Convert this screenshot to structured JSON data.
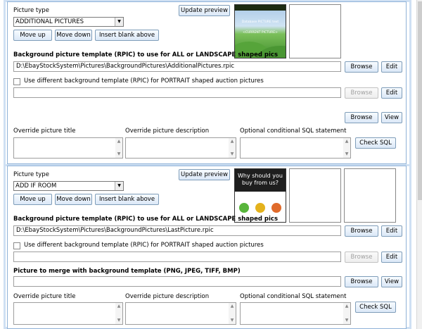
{
  "sections": [
    {
      "picture_type_label": "Picture type",
      "picture_type_value": "ADDITIONAL PICTURES",
      "update_preview": "Update preview",
      "move_up": "Move up",
      "move_down": "Move down",
      "insert_blank_above": "Insert blank above",
      "rpic_label": "Background picture template (RPIC) to use for ALL or LANDSCAPE shaped pics",
      "rpic_path": "D:\\EbayStockSystem\\Pictures\\BackgroundPictures\\AdditionalPictures.rpic",
      "browse": "Browse",
      "edit": "Edit",
      "portrait_checkbox_label": "Use different background template (RPIC) for PORTRAIT shaped auction pictures",
      "portrait_path": "",
      "portrait_browse": "Browse",
      "portrait_edit": "Edit",
      "extra_browse": "Browse",
      "extra_view": "View",
      "override_title_label": "Override picture title",
      "override_desc_label": "Override picture description",
      "sql_label": "Optional conditional SQL statement",
      "check_sql": "Check SQL",
      "thumb_title": "Database PICTURE text",
      "thumb_sub": "<CURRENT PICTURE>"
    },
    {
      "picture_type_label": "Picture type",
      "picture_type_value": "ADD IF ROOM",
      "update_preview": "Update preview",
      "move_up": "Move up",
      "move_down": "Move down",
      "insert_blank_above": "Insert blank above",
      "rpic_label": "Background picture template (RPIC) to use for ALL or LANDSCAPE shaped pics",
      "rpic_path": "D:\\EbayStockSystem\\Pictures\\BackgroundPictures\\LastPicture.rpic",
      "browse": "Browse",
      "edit": "Edit",
      "portrait_checkbox_label": "Use different background template (RPIC) for PORTRAIT shaped auction pictures",
      "portrait_path": "",
      "portrait_browse": "Browse",
      "portrait_edit": "Edit",
      "merge_label": "Picture to merge with background template (PNG, JPEG, TIFF, BMP)",
      "merge_path": "",
      "extra_browse": "Browse",
      "extra_view": "View",
      "override_title_label": "Override picture title",
      "override_desc_label": "Override picture description",
      "sql_label": "Optional conditional SQL statement",
      "check_sql": "Check SQL",
      "thumb_title": "Why should you buy from us?"
    }
  ],
  "icons": {
    "select_arrow": "chevron-down-icon",
    "scroll_up": "arrow-up-icon",
    "scroll_down": "arrow-down-icon"
  },
  "colors": {
    "panel_border": "#8fb2d8",
    "panel_outer": "#cfe0f3",
    "button_top": "#f7fbff",
    "button_bottom": "#dbe8f7"
  }
}
